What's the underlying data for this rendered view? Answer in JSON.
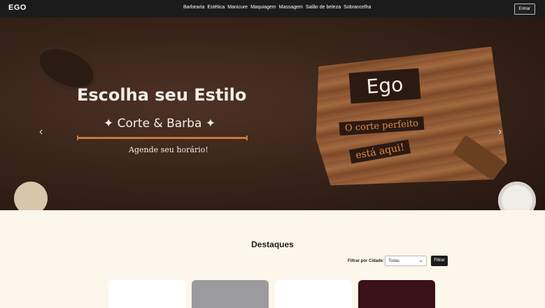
{
  "nav": {
    "brand": "EGO",
    "links": [
      "Barbearia",
      "Estética",
      "Manicure",
      "Maquiagem",
      "Massagem",
      "Salão de beleza",
      "Sobrancelha"
    ],
    "enter_label": "Entrar"
  },
  "hero": {
    "title": "Escolha seu Estilo",
    "subtitle": "✦ Corte & Barba ✦",
    "cta": "Agende seu horário!",
    "sign_main": "Ego",
    "sign_line1": "O corte perfeito",
    "sign_line2": "está aqui!",
    "prev_icon": "‹",
    "next_icon": "›"
  },
  "featured": {
    "title": "Destaques",
    "filter_label": "Filtrar por Cidade:",
    "city_selected": "Todas",
    "filter_button": "Filtrar"
  }
}
